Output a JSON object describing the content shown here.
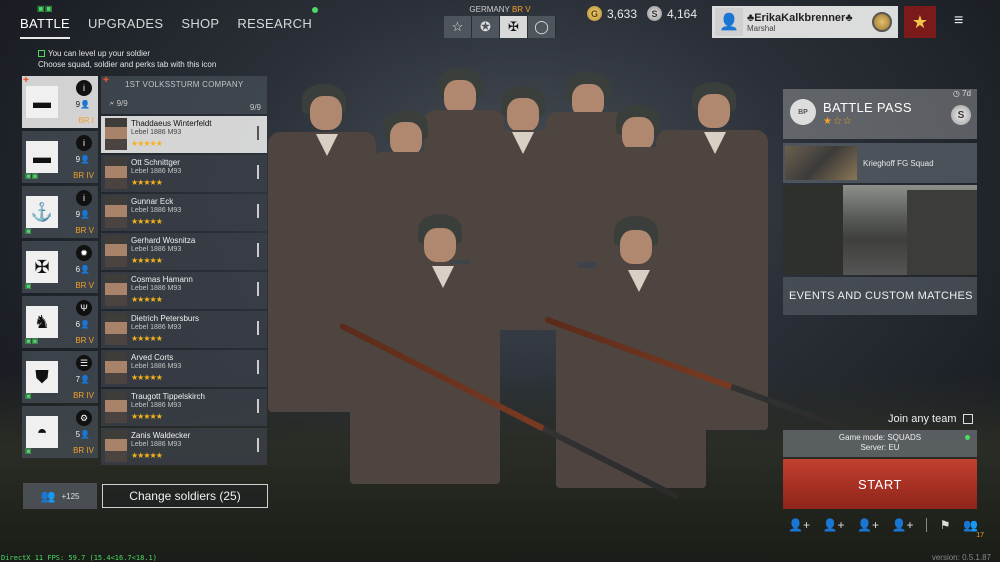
{
  "nav": {
    "tabs": [
      {
        "label": "BATTLE",
        "active": true
      },
      {
        "label": "UPGRADES"
      },
      {
        "label": "SHOP"
      },
      {
        "label": "RESEARCH"
      }
    ]
  },
  "hint": {
    "line1": "You can level up your soldier",
    "line2": "Choose squad, soldier and perks tab with this icon"
  },
  "nation": {
    "label": "GERMANY",
    "br": "BR V",
    "icons": [
      "star-outline-icon",
      "star-filled-icon",
      "balkenkreuz-icon",
      "circle-icon"
    ],
    "glyphs": [
      "☆",
      "✪",
      "✠",
      "◯"
    ]
  },
  "currency": {
    "gold": "3,633",
    "silver": "4,164"
  },
  "profile": {
    "name": "♣ErikaKalkbrenner♣",
    "rank": "Marshal"
  },
  "squads": [
    {
      "icon": "infantry-flag-icon",
      "glyph": "▬",
      "count": "9",
      "br": "BR I",
      "selected": true
    },
    {
      "icon": "flag-icon",
      "glyph": "▬",
      "count": "9",
      "br": "BR IV"
    },
    {
      "icon": "anchor-icon",
      "glyph": "⚓",
      "count": "9",
      "br": "BR V"
    },
    {
      "icon": "iron-cross-icon",
      "glyph": "✠",
      "count": "6",
      "br": "BR V"
    },
    {
      "icon": "bison-icon",
      "glyph": "♞",
      "count": "6",
      "br": "BR V"
    },
    {
      "icon": "crest-icon",
      "glyph": "⛊",
      "count": "7",
      "br": "BR IV"
    },
    {
      "icon": "helmet-icon",
      "glyph": "◓",
      "count": "5",
      "br": "BR IV"
    }
  ],
  "company": {
    "name": "1ST VOLKSSTURM COMPANY",
    "fill": "9/9",
    "max": "9/9"
  },
  "soldiers": [
    {
      "name": "Thaddaeus Winterfeldt",
      "weapon": "Lebel 1886 M93",
      "stars": "★★★★★",
      "selected": true
    },
    {
      "name": "Ott Schnittger",
      "weapon": "Lebel 1886 M93",
      "stars": "★★★★★"
    },
    {
      "name": "Gunnar Eck",
      "weapon": "Lebel 1886 M93",
      "stars": "★★★★★"
    },
    {
      "name": "Gerhard Wosnitza",
      "weapon": "Lebel 1886 M93",
      "stars": "★★★★★"
    },
    {
      "name": "Cosmas Hamann",
      "weapon": "Lebel 1886 M93",
      "stars": "★★★★★"
    },
    {
      "name": "Dietrich Petersburs",
      "weapon": "Lebel 1886 M93",
      "stars": "★★★★★"
    },
    {
      "name": "Arved Corts",
      "weapon": "Lebel 1886 M93",
      "stars": "★★★★★"
    },
    {
      "name": "Traugott Tippelskirch",
      "weapon": "Lebel 1886 M93",
      "stars": "★★★★★"
    },
    {
      "name": "Zanis Waldecker",
      "weapon": "Lebel 1886 M93",
      "stars": "★★★★★"
    }
  ],
  "reserve": {
    "count": "+125"
  },
  "change_soldiers": "Change soldiers (25)",
  "battle_pass": {
    "title": "BATTLE PASS",
    "stars": "★☆☆",
    "timer": "7d",
    "logo": "BP"
  },
  "event": {
    "title": "Krieghoff FG Squad"
  },
  "events_button": "EVENTS AND CUSTOM MATCHES",
  "join": {
    "label": "Join any team"
  },
  "mode": {
    "line1": "Game mode: SQUADS",
    "line2": "Server: EU"
  },
  "start": "START",
  "actions": {
    "friends_count": "17"
  },
  "debug": "DirectX 11 FPS: 59.7 (15.4<16.7<18.1)",
  "version": "version: 0.5.1.87",
  "colors": {
    "accent": "#f4a02a",
    "positive": "#4cd964",
    "start": "#b2372a"
  }
}
